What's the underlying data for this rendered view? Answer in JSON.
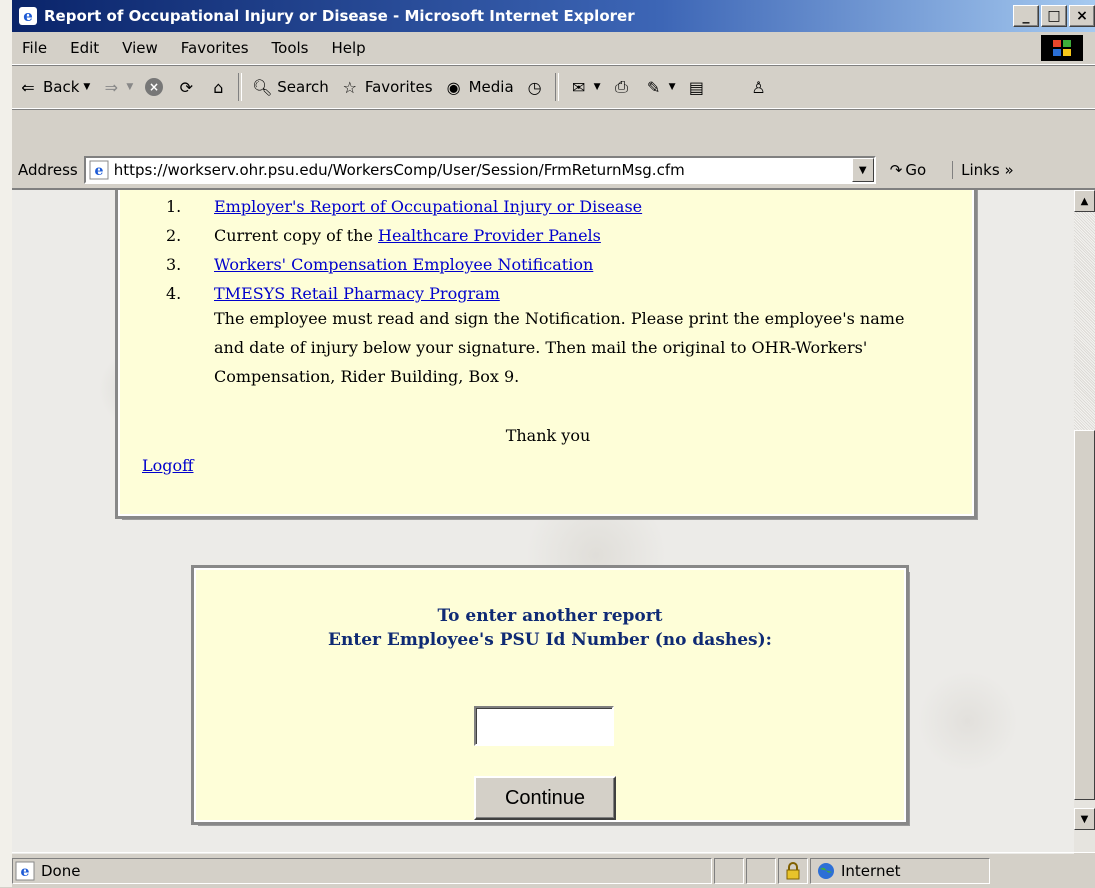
{
  "window": {
    "title": "Report of Occupational Injury or Disease - Microsoft Internet Explorer",
    "minimize": "_",
    "maximize": "□",
    "close": "×"
  },
  "menu": [
    "File",
    "Edit",
    "View",
    "Favorites",
    "Tools",
    "Help"
  ],
  "toolbar": {
    "back": "Back",
    "search": "Search",
    "favorites": "Favorites",
    "media": "Media"
  },
  "address": {
    "label": "Address",
    "url": "https://workserv.ohr.psu.edu/WorkersComp/User/Session/FrmReturnMsg.cfm",
    "go": "Go",
    "links": "Links »"
  },
  "content": {
    "documents": [
      {
        "num": "1.",
        "prefix": "",
        "link": "Employer's Report of Occupational Injury or Disease"
      },
      {
        "num": "2.",
        "prefix": "Current copy of the ",
        "link": "Healthcare Provider Panels"
      },
      {
        "num": "3.",
        "prefix": "",
        "link": "Workers' Compensation Employee Notification"
      },
      {
        "num": "4.",
        "prefix": "",
        "link": "TMESYS Retail Pharmacy Program"
      }
    ],
    "notice": "The employee must read and sign the Notification. Please print the employee's name and date of injury below your signature. Then mail the original to OHR-Workers' Compensation, Rider Building, Box 9.",
    "thanks": "Thank you",
    "logoff": "Logoff"
  },
  "entry": {
    "line1": "To enter another report",
    "line2": "Enter Employee's PSU Id Number (no dashes):",
    "value": "",
    "button": "Continue"
  },
  "status": {
    "text": "Done",
    "zone": "Internet"
  }
}
